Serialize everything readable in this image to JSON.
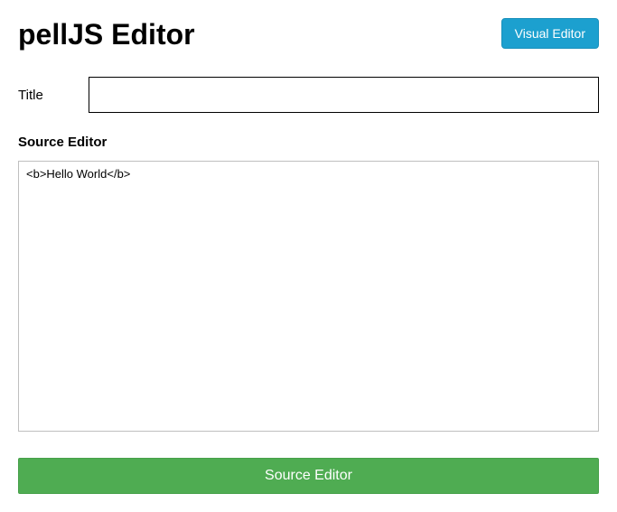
{
  "header": {
    "title": "pellJS Editor",
    "visual_editor_button": "Visual Editor"
  },
  "form": {
    "title_label": "Title",
    "title_value": "",
    "title_placeholder": ""
  },
  "source": {
    "heading": "Source Editor",
    "content": "<b>Hello World</b>"
  },
  "footer": {
    "source_editor_button": "Source Editor"
  }
}
